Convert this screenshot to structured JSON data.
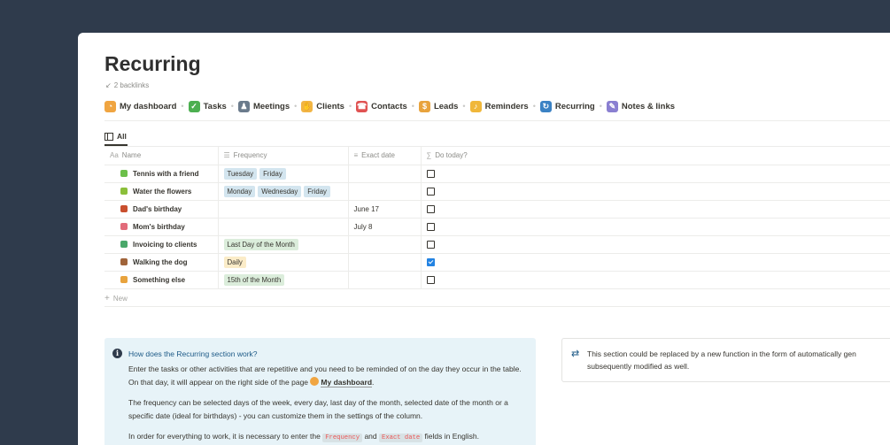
{
  "page": {
    "title": "Recurring",
    "backlinks_arrow": "↙",
    "backlinks": "2 backlinks"
  },
  "nav": [
    {
      "label": "My dashboard",
      "icon": "dashboard-icon",
      "color": "#f0a541",
      "glyph": "◔"
    },
    {
      "label": "Tasks",
      "icon": "checkbox-icon",
      "color": "#4caf50",
      "glyph": "✓"
    },
    {
      "label": "Meetings",
      "icon": "meeting-icon",
      "color": "#6b7b8c",
      "glyph": "♟"
    },
    {
      "label": "Clients",
      "icon": "handshake-icon",
      "color": "#f2b544",
      "glyph": "✋"
    },
    {
      "label": "Contacts",
      "icon": "contacts-icon",
      "color": "#e05252",
      "glyph": "☎"
    },
    {
      "label": "Leads",
      "icon": "leads-icon",
      "color": "#e8a33d",
      "glyph": "$"
    },
    {
      "label": "Reminders",
      "icon": "bell-icon",
      "color": "#f0b73a",
      "glyph": "♪"
    },
    {
      "label": "Recurring",
      "icon": "recurring-icon",
      "color": "#3b82c4",
      "glyph": "↻"
    },
    {
      "label": "Notes & links",
      "icon": "notes-icon",
      "color": "#8a7fd1",
      "glyph": "✎"
    }
  ],
  "view": {
    "tab_label": "All"
  },
  "table": {
    "headers": [
      {
        "icon": "Aa",
        "label": "Name"
      },
      {
        "icon": "☰",
        "label": "Frequency"
      },
      {
        "icon": "≡",
        "label": "Exact date"
      },
      {
        "icon": "∑",
        "label": "Do today?"
      }
    ],
    "rows": [
      {
        "name": "Tennis with a friend",
        "icon_color": "#6cbf4a",
        "frequency": [
          {
            "label": "Tuesday",
            "color": "blue"
          },
          {
            "label": "Friday",
            "color": "blue"
          }
        ],
        "exact_date": "",
        "do_today": false
      },
      {
        "name": "Water the flowers",
        "icon_color": "#8bbf3a",
        "frequency": [
          {
            "label": "Monday",
            "color": "blue"
          },
          {
            "label": "Wednesday",
            "color": "blue"
          },
          {
            "label": "Friday",
            "color": "blue"
          }
        ],
        "exact_date": "",
        "do_today": false
      },
      {
        "name": "Dad's birthday",
        "icon_color": "#c94f2e",
        "frequency": [],
        "exact_date": "June 17",
        "do_today": false
      },
      {
        "name": "Mom's birthday",
        "icon_color": "#e26b7a",
        "frequency": [],
        "exact_date": "July 8",
        "do_today": false
      },
      {
        "name": "Invoicing to clients",
        "icon_color": "#4aa86a",
        "frequency": [
          {
            "label": "Last Day of the Month",
            "color": "green"
          }
        ],
        "exact_date": "",
        "do_today": false
      },
      {
        "name": "Walking the dog",
        "icon_color": "#a0643a",
        "frequency": [
          {
            "label": "Daily",
            "color": "yellow"
          }
        ],
        "exact_date": "",
        "do_today": true
      },
      {
        "name": "Something else",
        "icon_color": "#e8a33d",
        "frequency": [
          {
            "label": "15th of the Month",
            "color": "green"
          }
        ],
        "exact_date": "",
        "do_today": false
      }
    ],
    "new_label": "New"
  },
  "callout": {
    "title": "How does the Recurring section work?",
    "p1_before": "Enter the tasks or other activities that are repetitive and you need to be reminded of on the day they occur in the table. On that day, it will appear on the right side of the page",
    "p1_link": "My dashboard",
    "p1_after": ".",
    "p2": "The frequency can be selected days of the week, every day, last day of the month, selected date of the month or a specific date (ideal for birthdays) - you can customize them in the settings of the column.",
    "p3_before": "In order for everything to work, it is necessary to enter the",
    "p3_code1": "Frequency",
    "p3_mid": "and",
    "p3_code2": "Exact date",
    "p3_after": "fields in English."
  },
  "callout2": {
    "line1": "This section could be replaced by a new function in the form of automatically gen",
    "line2": "subsequently modified as well."
  }
}
